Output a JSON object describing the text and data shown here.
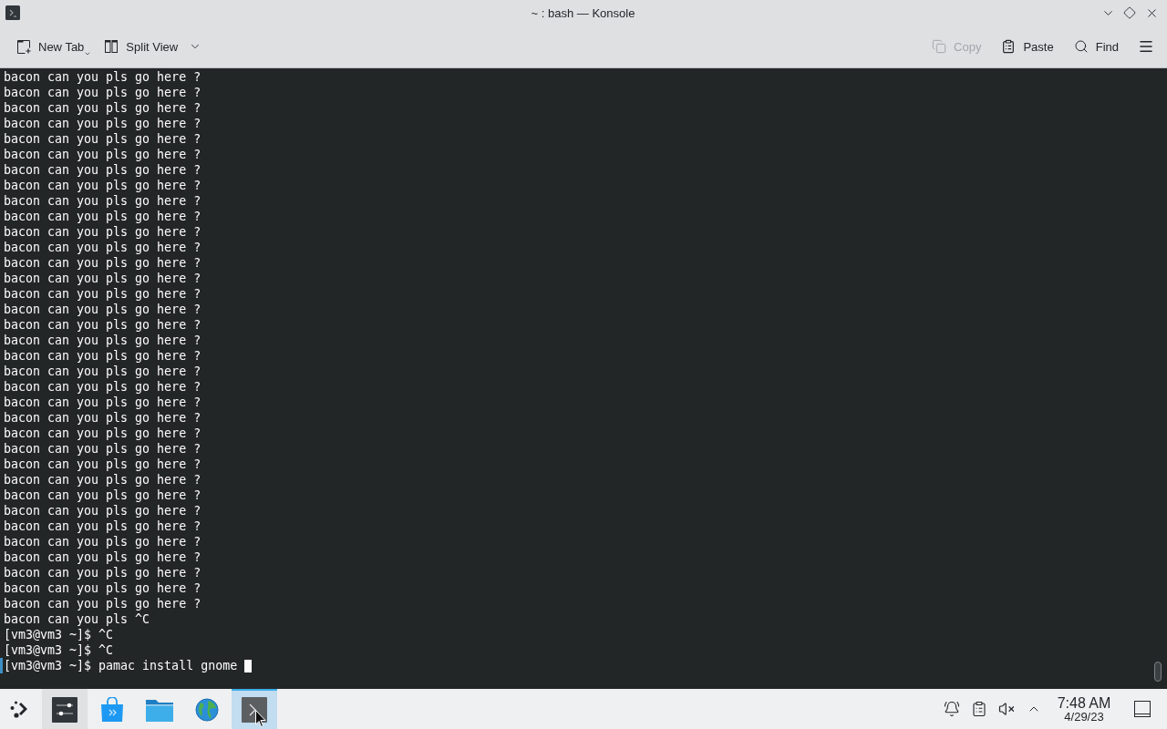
{
  "window": {
    "title": "~ : bash — Konsole"
  },
  "toolbar": {
    "left": [
      {
        "kind": "new-tab",
        "label": "New Tab",
        "disabled": false
      },
      {
        "kind": "split-view",
        "label": "Split View",
        "disabled": false
      }
    ],
    "right": [
      {
        "kind": "copy",
        "label": "Copy",
        "disabled": true
      },
      {
        "kind": "paste",
        "label": "Paste",
        "disabled": false
      },
      {
        "kind": "find",
        "label": "Find",
        "disabled": false
      }
    ]
  },
  "terminal": {
    "lines": [
      "bacon can you pls go here ?",
      "bacon can you pls go here ?",
      "bacon can you pls go here ?",
      "bacon can you pls go here ?",
      "bacon can you pls go here ?",
      "bacon can you pls go here ?",
      "bacon can you pls go here ?",
      "bacon can you pls go here ?",
      "bacon can you pls go here ?",
      "bacon can you pls go here ?",
      "bacon can you pls go here ?",
      "bacon can you pls go here ?",
      "bacon can you pls go here ?",
      "bacon can you pls go here ?",
      "bacon can you pls go here ?",
      "bacon can you pls go here ?",
      "bacon can you pls go here ?",
      "bacon can you pls go here ?",
      "bacon can you pls go here ?",
      "bacon can you pls go here ?",
      "bacon can you pls go here ?",
      "bacon can you pls go here ?",
      "bacon can you pls go here ?",
      "bacon can you pls go here ?",
      "bacon can you pls go here ?",
      "bacon can you pls go here ?",
      "bacon can you pls go here ?",
      "bacon can you pls go here ?",
      "bacon can you pls go here ?",
      "bacon can you pls go here ?",
      "bacon can you pls go here ?",
      "bacon can you pls go here ?",
      "bacon can you pls go here ?",
      "bacon can you pls go here ?",
      "bacon can you pls go here ?",
      "bacon can you pls ^C",
      "[vm3@vm3 ~]$ ^C",
      "[vm3@vm3 ~]$ ^C"
    ],
    "current_line": "[vm3@vm3 ~]$ pamac install gnome"
  },
  "taskbar": {
    "tasks": [
      {
        "kind": "settings",
        "highlighted": true,
        "selected": false
      },
      {
        "kind": "store",
        "highlighted": false,
        "selected": false
      },
      {
        "kind": "files",
        "highlighted": false,
        "selected": false
      },
      {
        "kind": "browser",
        "highlighted": false,
        "selected": false
      },
      {
        "kind": "terminal",
        "highlighted": false,
        "selected": true
      }
    ],
    "clock": {
      "time": "7:48 AM",
      "date": "4/29/23"
    }
  }
}
